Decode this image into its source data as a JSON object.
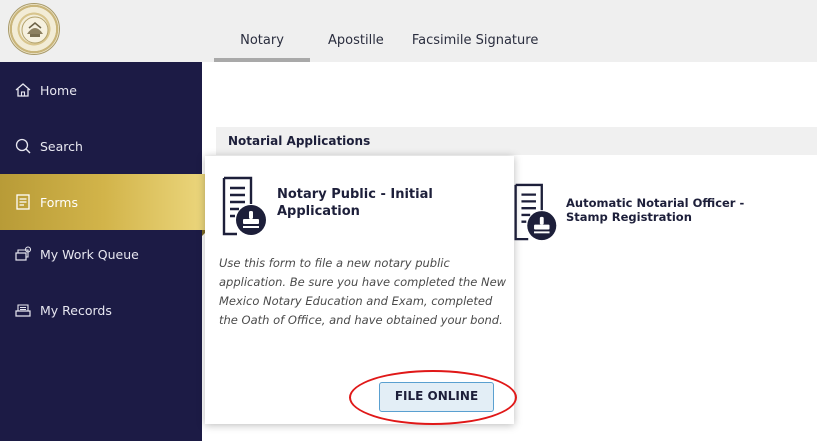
{
  "header": {
    "seal_alt": "New Mexico state seal",
    "tabs": [
      {
        "label": "Notary",
        "active": true
      },
      {
        "label": "Apostille",
        "active": false
      },
      {
        "label": "Facsimile Signature",
        "active": false
      }
    ]
  },
  "sidebar": {
    "items": [
      {
        "label": "Home",
        "icon": "home-icon",
        "active": false
      },
      {
        "label": "Search",
        "icon": "search-icon",
        "active": false
      },
      {
        "label": "Forms",
        "icon": "document-icon",
        "active": true
      },
      {
        "label": "My Work Queue",
        "icon": "work-queue-icon",
        "active": false
      },
      {
        "label": "My Records",
        "icon": "records-icon",
        "active": false
      }
    ]
  },
  "main": {
    "section_title": "Notarial Applications",
    "forms": [
      {
        "title": "Notary Public - Initial Application",
        "icon": "form-stamp-icon",
        "description": "Use this form to file a new notary public application. Be sure you have completed the New Mexico Notary Education and Exam, completed the Oath of Office, and have obtained your bond.",
        "button_label": "FILE ONLINE"
      },
      {
        "title": "Automatic Notarial Officer - Stamp Registration",
        "icon": "form-stamp-icon"
      }
    ]
  },
  "colors": {
    "sidebar_bg": "#1c1b45",
    "active_nav_gold": "#d2b44a",
    "button_border": "#5aa0d0",
    "highlight_ring": "#e01818"
  }
}
